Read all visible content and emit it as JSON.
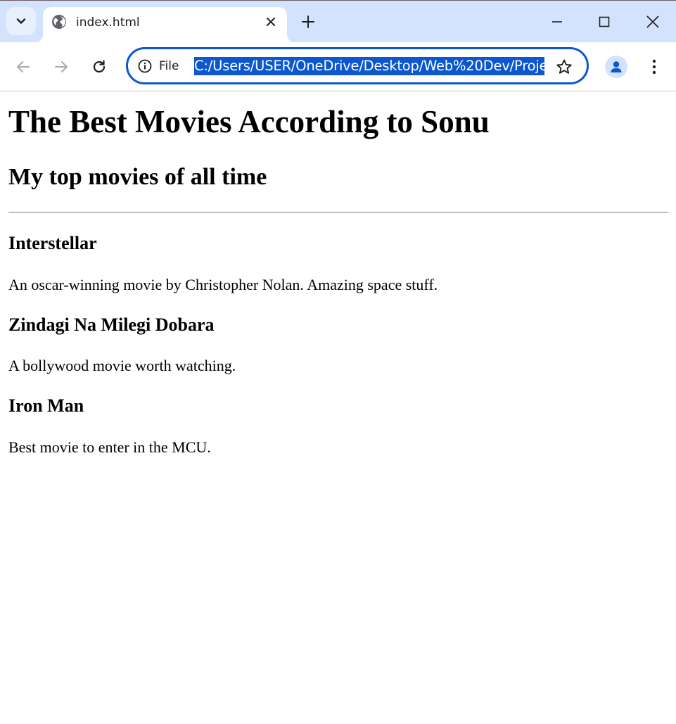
{
  "browser": {
    "tab": {
      "title": "index.html"
    },
    "address_bar": {
      "scheme_label": "File",
      "url": "C:/Users/USER/OneDrive/Desktop/Web%20Dev/Proje"
    }
  },
  "page": {
    "heading": "The Best Movies According to Sonu",
    "subheading": "My top movies of all time",
    "movies": [
      {
        "title": "Interstellar",
        "description": "An oscar-winning movie by Christopher Nolan. Amazing space stuff."
      },
      {
        "title": "Zindagi Na Milegi Dobara",
        "description": "A bollywood movie worth watching."
      },
      {
        "title": "Iron Man",
        "description": "Best movie to enter in the MCU."
      }
    ]
  },
  "colors": {
    "tabstrip_bg": "#d3e3fd",
    "accent": "#0b57d0",
    "page_bg": "#ffffff"
  }
}
